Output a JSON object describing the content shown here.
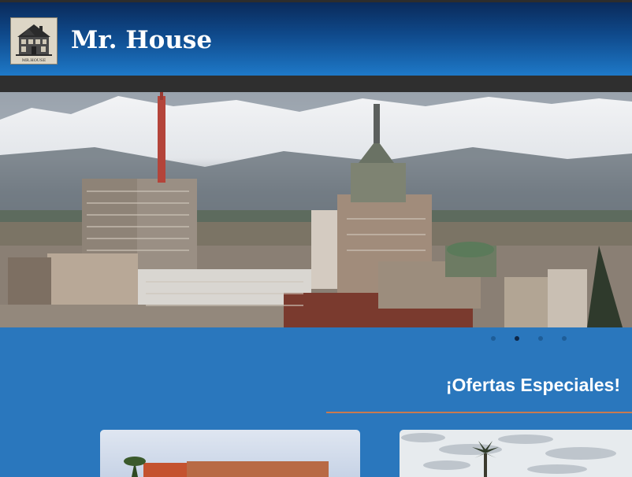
{
  "header": {
    "title": "Mr. House",
    "logo_caption": "MR.HOUSE",
    "colors": {
      "gradient_top": "#0a2a5a",
      "gradient_bottom": "#1e79c8"
    }
  },
  "hero": {
    "image": "city skyline with snow-capped mountains",
    "slides": [
      {
        "label": "slide-1",
        "active": false
      },
      {
        "label": "slide-2",
        "active": true
      },
      {
        "label": "slide-3",
        "active": false
      },
      {
        "label": "slide-4",
        "active": false
      }
    ]
  },
  "offers": {
    "heading": "¡Ofertas Especiales!",
    "cards": [
      {
        "image": "house with red roof and palm tree"
      },
      {
        "image": "palm tree under cloudy sky"
      }
    ]
  },
  "colors": {
    "page_background": "#2a77bd",
    "navbar": "#2f2f2f",
    "divider": "#c87a4f"
  }
}
